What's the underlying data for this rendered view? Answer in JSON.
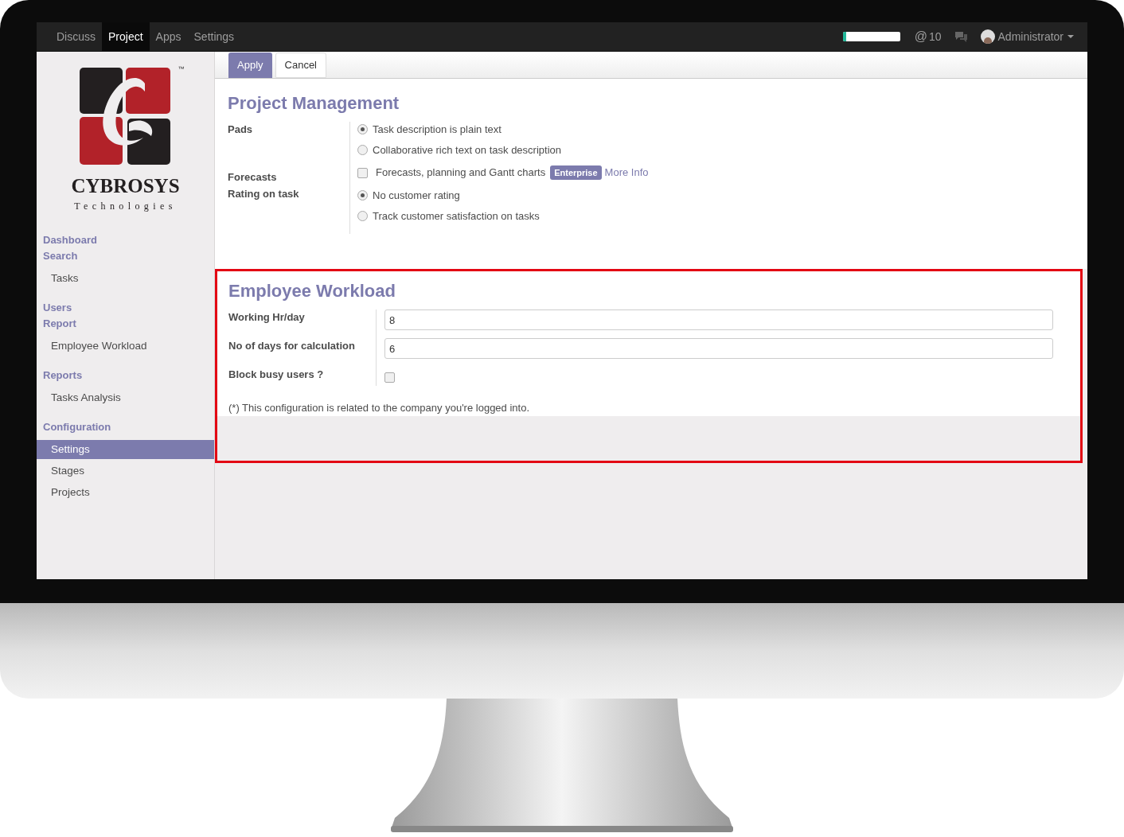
{
  "top_menu": [
    {
      "label": "Discuss",
      "selected": false
    },
    {
      "label": "Project",
      "selected": true
    },
    {
      "label": "Apps",
      "selected": false
    },
    {
      "label": "Settings",
      "selected": false
    }
  ],
  "systray": {
    "progress": {
      "level": 0.06
    },
    "mentions": "@",
    "mention_count": "10",
    "user": "Administrator"
  },
  "buttons": [
    {
      "label": "Apply",
      "kind": "primary"
    },
    {
      "label": "Cancel",
      "kind": "default"
    }
  ],
  "logo": {
    "name": "CYBROSYS",
    "tagline": "Technologies",
    "trademark": "™"
  },
  "sidebar": [
    {
      "heading": "Dashboard"
    },
    {
      "heading": "Search",
      "items": [
        {
          "label": "Tasks",
          "selected": false
        }
      ]
    },
    {
      "heading": "Users"
    },
    {
      "heading": "Report",
      "items": [
        {
          "label": "Employee Workload",
          "selected": false
        }
      ]
    },
    {
      "heading": "Reports",
      "items": [
        {
          "label": "Tasks Analysis",
          "selected": false
        }
      ]
    },
    {
      "heading": "Configuration",
      "items": [
        {
          "label": "Settings",
          "selected": true
        },
        {
          "label": "Stages",
          "selected": false
        },
        {
          "label": "Projects",
          "selected": false
        }
      ]
    }
  ],
  "sections": [
    {
      "title": "Project Management",
      "highlighted": false,
      "rows": [
        {
          "label": "Pads",
          "kind": "radio",
          "options": [
            {
              "label": "Task description is plain text",
              "selected": true
            },
            {
              "label": "Collaborative rich text on task description",
              "selected": false
            }
          ]
        },
        {
          "label": "Forecasts",
          "kind": "checkbox",
          "option": "Forecasts, planning and Gantt charts",
          "checked": false,
          "badge": "Enterprise",
          "link": "More Info"
        },
        {
          "label": "Rating on task",
          "kind": "radio",
          "options": [
            {
              "label": "No customer rating",
              "selected": true
            },
            {
              "label": "Track customer satisfaction on tasks",
              "selected": false
            }
          ]
        }
      ]
    },
    {
      "title": "Employee Workload",
      "highlighted": true,
      "rows": [
        {
          "label": "Working Hr/day",
          "kind": "input",
          "value": "8"
        },
        {
          "label": "No of days for calculation",
          "kind": "input",
          "value": "6"
        },
        {
          "label": "Block busy users ?",
          "kind": "checkbox",
          "checked": false
        }
      ],
      "note": "(*) This configuration is related to the company you're logged into."
    }
  ]
}
